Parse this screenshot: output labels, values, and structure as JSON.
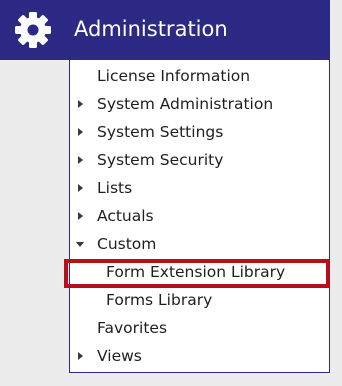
{
  "header": {
    "title": "Administration",
    "icon": "gear-icon",
    "background": "#2d2a85"
  },
  "menu": {
    "items": [
      {
        "label": "License Information",
        "caret": "none"
      },
      {
        "label": "System Administration",
        "caret": "right"
      },
      {
        "label": "System Settings",
        "caret": "right"
      },
      {
        "label": "System Security",
        "caret": "right"
      },
      {
        "label": "Lists",
        "caret": "right"
      },
      {
        "label": "Actuals",
        "caret": "right"
      },
      {
        "label": "Custom",
        "caret": "down"
      },
      {
        "label": "Form Extension Library",
        "caret": "none",
        "highlighted": true
      },
      {
        "label": "Forms Library",
        "caret": "none"
      },
      {
        "label": "Favorites",
        "caret": "none"
      },
      {
        "label": "Views",
        "caret": "right"
      }
    ]
  },
  "highlight_color": "#b50f1c"
}
